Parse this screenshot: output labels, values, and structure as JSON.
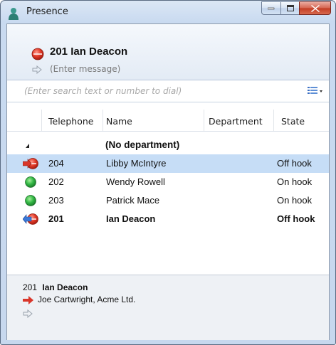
{
  "window": {
    "title": "Presence"
  },
  "header": {
    "user": "201 Ian Deacon",
    "message_placeholder": "(Enter message)",
    "status_color": "#e03b2c"
  },
  "search": {
    "placeholder": "(Enter search text or number to dial)"
  },
  "table": {
    "columns": [
      "Telephone",
      "Name",
      "Department",
      "State"
    ],
    "group_label": "(No department)",
    "rows": [
      {
        "telephone": "204",
        "name": "Libby McIntyre",
        "state": "Off hook",
        "icon": "call-incoming-red-icon",
        "selected": true
      },
      {
        "telephone": "202",
        "name": "Wendy Rowell",
        "state": "On hook",
        "icon": "status-green-icon",
        "selected": false
      },
      {
        "telephone": "203",
        "name": "Patrick Mace",
        "state": "On hook",
        "icon": "status-green-icon",
        "selected": false
      },
      {
        "telephone": "201",
        "name": "Ian Deacon",
        "state": "Off hook",
        "icon": "call-outgoing-red-icon",
        "selected": false,
        "bold": true
      }
    ]
  },
  "detail": {
    "number": "201",
    "name": "Ian Deacon",
    "call": "Joe Cartwright, Acme Ltd."
  },
  "colors": {
    "accent": "#c6ddf6",
    "busy": "#e03b2c",
    "free": "#2fb24a"
  }
}
